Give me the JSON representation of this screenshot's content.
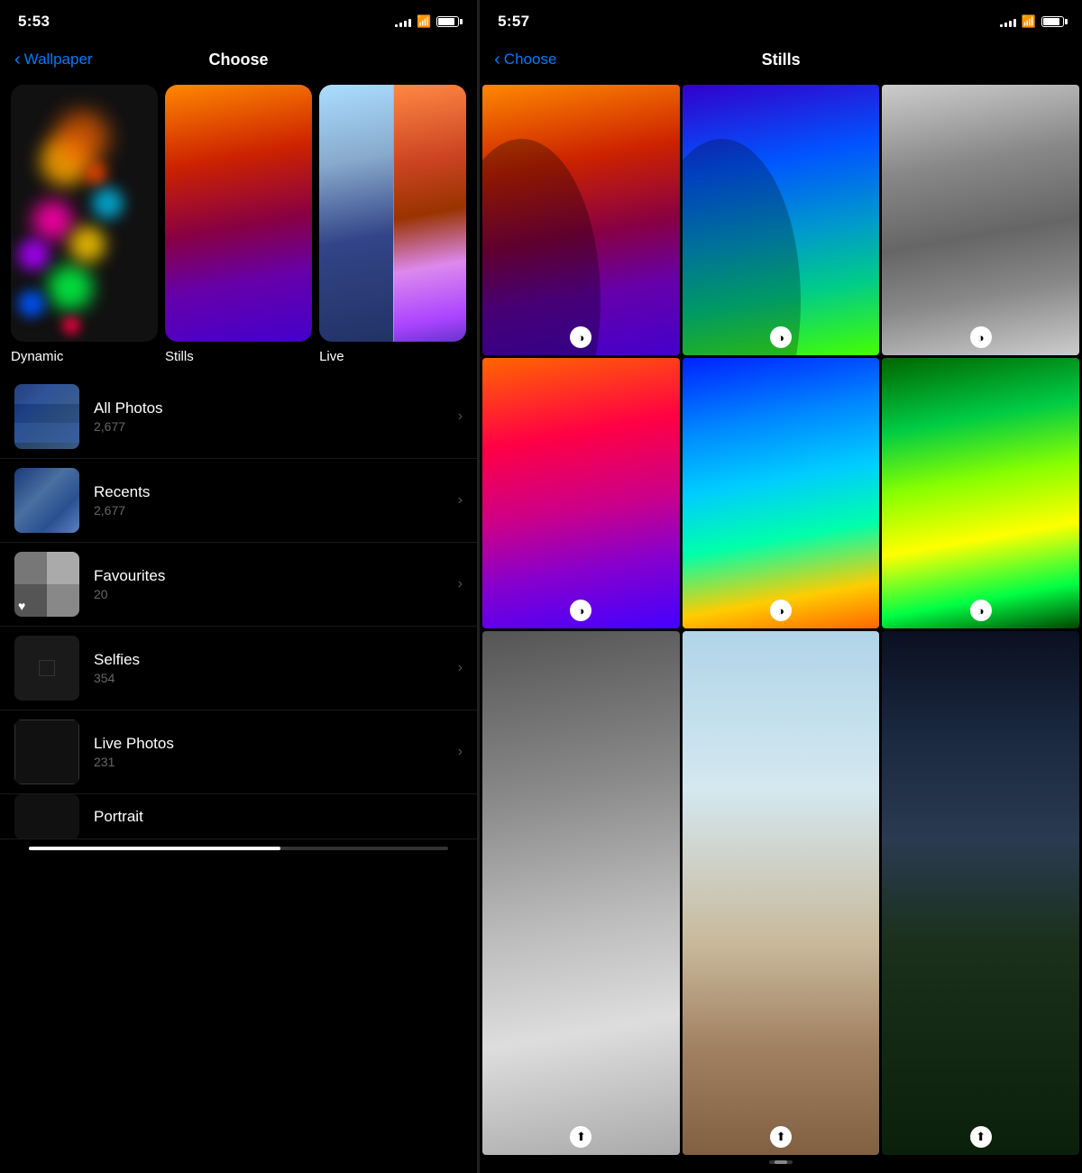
{
  "left": {
    "statusBar": {
      "time": "5:53",
      "signalBars": [
        3,
        5,
        7,
        9,
        11
      ],
      "battery": 85
    },
    "nav": {
      "backLabel": "Wallpaper",
      "title": "Choose"
    },
    "wallpaperCategories": [
      {
        "id": "dynamic",
        "label": "Dynamic"
      },
      {
        "id": "stills",
        "label": "Stills"
      },
      {
        "id": "live",
        "label": "Live"
      }
    ],
    "photoAlbums": [
      {
        "id": "all-photos",
        "title": "All Photos",
        "count": "2,677"
      },
      {
        "id": "recents",
        "title": "Recents",
        "count": "2,677"
      },
      {
        "id": "favourites",
        "title": "Favourites",
        "count": "20"
      },
      {
        "id": "selfies",
        "title": "Selfies",
        "count": "354"
      },
      {
        "id": "live-photos",
        "title": "Live Photos",
        "count": "231"
      },
      {
        "id": "portrait",
        "title": "Portrait",
        "count": ""
      }
    ]
  },
  "right": {
    "statusBar": {
      "time": "5:57"
    },
    "nav": {
      "backLabel": "Choose",
      "title": "Stills"
    },
    "dayNightIconLabel": "☯",
    "rows": [
      [
        {
          "id": "wp-r1-c1",
          "style": "ios1"
        },
        {
          "id": "wp-r1-c2",
          "style": "ios2"
        },
        {
          "id": "wp-r1-c3",
          "style": "ios3"
        }
      ],
      [
        {
          "id": "wp-r2-c1",
          "style": "ios-r2-1"
        },
        {
          "id": "wp-r2-c2",
          "style": "ios-r2-2"
        },
        {
          "id": "wp-r2-c3",
          "style": "ios-r2-3"
        }
      ],
      [
        {
          "id": "wp-r3-c1",
          "style": "ios-r3-1"
        },
        {
          "id": "wp-r3-c2",
          "style": "ios-r3-2"
        },
        {
          "id": "wp-r3-c3",
          "style": "ios-r3-3"
        }
      ]
    ]
  }
}
